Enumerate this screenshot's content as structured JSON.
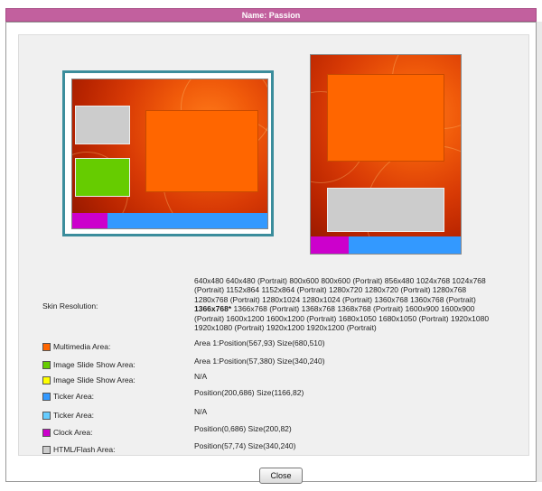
{
  "title": "Name: Passion",
  "resolution": {
    "label": "Skin Resolution:",
    "values": [
      "640x480 640x480 (Portrait) 800x600 800x600 (Portrait) 856x480 1024x768 1024x768",
      "(Portrait) 1152x864 1152x864 (Portrait) 1280x720 1280x720 (Portrait) 1280x768",
      "1280x768 (Portrait) 1280x1024 1280x1024 (Portrait) 1360x768 1360x768 (Portrait)",
      "1366x768* 1366x768 (Portrait) 1368x768 1368x768 (Portrait) 1600x900 1600x900",
      "(Portrait) 1600x1200 1600x1200 (Portrait) 1680x1050 1680x1050 (Portrait) 1920x1080",
      "1920x1080 (Portrait) 1920x1200 1920x1200 (Portrait)"
    ],
    "highlight": "1366x768*"
  },
  "rows": [
    {
      "label": "Multimedia Area:",
      "value": "Area 1:Position(567,93)  Size(680,510)",
      "color": "#ff6600"
    },
    {
      "label": "Image Slide Show Area:",
      "value": "Area 1:Position(57,380)  Size(340,240)",
      "color": "#66cc00"
    },
    {
      "label": "Image Slide Show Area:",
      "value": "N/A",
      "color": "#ffff00"
    },
    {
      "label": "Ticker Area:",
      "value": "Position(200,686)  Size(1166,82)",
      "color": "#3399ff"
    },
    {
      "label": "Ticker Area:",
      "value": "N/A",
      "color": "#66ccff"
    },
    {
      "label": "Clock Area:",
      "value": "Position(0,686)  Size(200,82)",
      "color": "#cc00cc"
    },
    {
      "label": "HTML/Flash Area:",
      "value": "Position(57,74)  Size(340,240)",
      "color": "#cccccc"
    }
  ],
  "close_label": "Close"
}
